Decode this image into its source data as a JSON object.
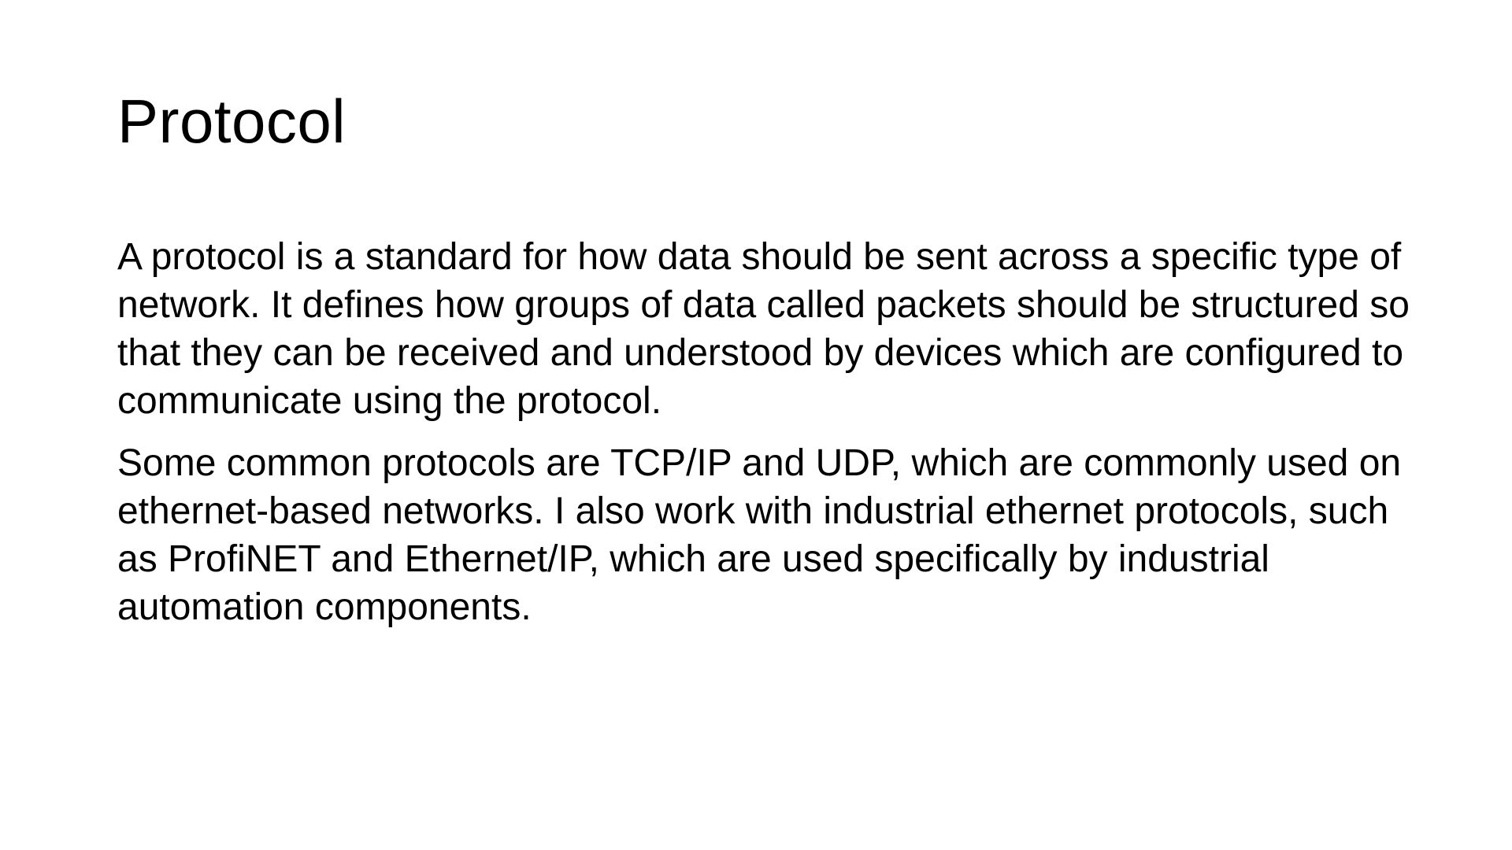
{
  "slide": {
    "title": "Protocol",
    "paragraphs": [
      "A protocol is a standard for how data should be sent across a specific type of network. It defines how groups of data called packets should be structured so that they can be received and understood by devices which are configured to communicate using the protocol.",
      "Some common protocols are TCP/IP and UDP, which are commonly used on ethernet-based networks. I also work with industrial ethernet protocols, such as ProfiNET and Ethernet/IP, which are used specifically by industrial automation components."
    ]
  }
}
